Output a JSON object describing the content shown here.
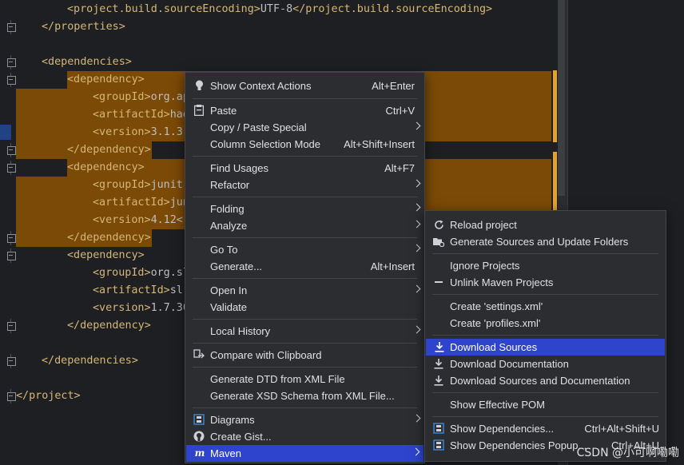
{
  "editor": {
    "lines": [
      {
        "open": "<project.build.sourceEncoding>",
        "text": "UTF-8",
        "close": "</project.build.sourceEncoding>"
      },
      {
        "open": "</properties>",
        "text": "",
        "close": ""
      },
      {
        "open": "",
        "text": "",
        "close": ""
      },
      {
        "open": "<dependencies>",
        "text": "",
        "close": ""
      },
      {
        "open": "<dependency>",
        "text": "",
        "close": ""
      },
      {
        "open": "<groupId>",
        "text": "org.ap",
        "close": ""
      },
      {
        "open": "<artifactId>",
        "text": "had",
        "close": ""
      },
      {
        "open": "<version>",
        "text": "3.1.3",
        "close": ""
      },
      {
        "open": "</dependency>",
        "text": "",
        "close": ""
      },
      {
        "open": "<dependency>",
        "text": "",
        "close": ""
      },
      {
        "open": "<groupId>",
        "text": "junit",
        "close": ""
      },
      {
        "open": "<artifactId>",
        "text": "jun",
        "close": ""
      },
      {
        "open": "<version>",
        "text": "4.12<",
        "close": ""
      },
      {
        "open": "</dependency>",
        "text": "",
        "close": ""
      },
      {
        "open": "<dependency>",
        "text": "",
        "close": ""
      },
      {
        "open": "<groupId>",
        "text": "org.sl",
        "close": ""
      },
      {
        "open": "<artifactId>",
        "text": "sl",
        "close": ""
      },
      {
        "open": "<version>",
        "text": "1.7.30",
        "close": ""
      },
      {
        "open": "</dependency>",
        "text": "",
        "close": ""
      },
      {
        "open": "",
        "text": "",
        "close": ""
      },
      {
        "open": "</dependencies>",
        "text": "",
        "close": ""
      },
      {
        "open": "",
        "text": "",
        "close": ""
      },
      {
        "open": "</project>",
        "text": "",
        "close": ""
      }
    ]
  },
  "context_menu": {
    "items": [
      {
        "icon": "bulb-icon",
        "label": "Show Context Actions",
        "shortcut": "Alt+Enter",
        "submenu": false
      },
      {
        "icon": "paste-icon",
        "label": "Paste",
        "shortcut": "Ctrl+V",
        "submenu": false
      },
      {
        "icon": "",
        "label": "Copy / Paste Special",
        "shortcut": "",
        "submenu": true
      },
      {
        "icon": "",
        "label": "Column Selection Mode",
        "shortcut": "Alt+Shift+Insert",
        "submenu": false
      },
      {
        "icon": "",
        "label": "Find Usages",
        "shortcut": "Alt+F7",
        "submenu": false
      },
      {
        "icon": "",
        "label": "Refactor",
        "shortcut": "",
        "submenu": true
      },
      {
        "icon": "",
        "label": "Folding",
        "shortcut": "",
        "submenu": true
      },
      {
        "icon": "",
        "label": "Analyze",
        "shortcut": "",
        "submenu": true
      },
      {
        "icon": "",
        "label": "Go To",
        "shortcut": "",
        "submenu": true
      },
      {
        "icon": "",
        "label": "Generate...",
        "shortcut": "Alt+Insert",
        "submenu": false
      },
      {
        "icon": "",
        "label": "Open In",
        "shortcut": "",
        "submenu": true
      },
      {
        "icon": "",
        "label": "Validate",
        "shortcut": "",
        "submenu": false
      },
      {
        "icon": "",
        "label": "Local History",
        "shortcut": "",
        "submenu": true
      },
      {
        "icon": "compare-icon",
        "label": "Compare with Clipboard",
        "shortcut": "",
        "submenu": false
      },
      {
        "icon": "",
        "label": "Generate DTD from XML File",
        "shortcut": "",
        "submenu": false
      },
      {
        "icon": "",
        "label": "Generate XSD Schema from XML File...",
        "shortcut": "",
        "submenu": false
      },
      {
        "icon": "diagram-icon",
        "label": "Diagrams",
        "shortcut": "",
        "submenu": true
      },
      {
        "icon": "github-icon",
        "label": "Create Gist...",
        "shortcut": "",
        "submenu": false
      },
      {
        "icon": "maven-icon",
        "label": "Maven",
        "shortcut": "",
        "submenu": true,
        "selected": true
      }
    ]
  },
  "maven_menu": {
    "items": [
      {
        "icon": "reload-icon",
        "label": "Reload project",
        "shortcut": ""
      },
      {
        "icon": "folder-gear-icon",
        "label": "Generate Sources and Update Folders",
        "shortcut": ""
      },
      {
        "icon": "",
        "label": "Ignore Projects",
        "shortcut": ""
      },
      {
        "icon": "minus-icon",
        "label": "Unlink Maven Projects",
        "shortcut": ""
      },
      {
        "icon": "",
        "label": "Create 'settings.xml'",
        "shortcut": ""
      },
      {
        "icon": "",
        "label": "Create 'profiles.xml'",
        "shortcut": ""
      },
      {
        "icon": "download-icon",
        "label": "Download Sources",
        "shortcut": "",
        "selected": true
      },
      {
        "icon": "download-icon",
        "label": "Download Documentation",
        "shortcut": ""
      },
      {
        "icon": "download-icon",
        "label": "Download Sources and Documentation",
        "shortcut": ""
      },
      {
        "icon": "",
        "label": "Show Effective POM",
        "shortcut": ""
      },
      {
        "icon": "dependency-icon",
        "label": "Show Dependencies...",
        "shortcut": "Ctrl+Alt+Shift+U"
      },
      {
        "icon": "dependency-icon",
        "label": "Show Dependencies Popup...",
        "shortcut": "Ctrl+Alt+U"
      }
    ]
  },
  "watermark": "CSDN @小可啊嘞嘞",
  "colors": {
    "highlight": "#7b4a06",
    "selection": "#2e44cc",
    "tag": "#d5b778",
    "marker": "#e3a12f"
  }
}
